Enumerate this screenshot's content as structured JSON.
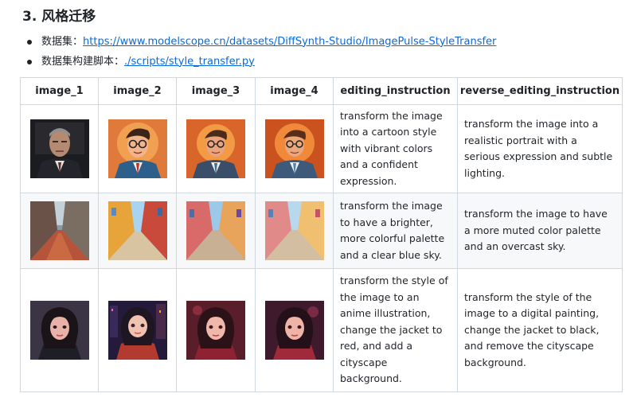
{
  "heading": "3. 风格迁移",
  "links": [
    {
      "label": "数据集：",
      "link": "https://www.modelscope.cn/datasets/DiffSynth-Studio/ImagePulse-StyleTransfer"
    },
    {
      "label": "数据集构建脚本：",
      "link": "./scripts/style_transfer.py"
    }
  ],
  "table": {
    "headers": [
      "image_1",
      "image_2",
      "image_3",
      "image_4",
      "editing_instruction",
      "reverse_editing_instruction"
    ],
    "rows": [
      {
        "editing_instruction": "transform the image into a cartoon style with vibrant colors and a confident expression.",
        "reverse_editing_instruction": "transform the image into a realistic portrait with a serious expression and subtle lighting."
      },
      {
        "editing_instruction": "transform the image to have a brighter, more colorful palette and a clear blue sky.",
        "reverse_editing_instruction": "transform the image to have a more muted color palette and an overcast sky."
      },
      {
        "editing_instruction": "transform the style of the image to an anime illustration, change the jacket to red, and add a cityscape background.",
        "reverse_editing_instruction": "transform the style of the image to a digital painting, change the jacket to black, and remove the cityscape background."
      }
    ]
  }
}
